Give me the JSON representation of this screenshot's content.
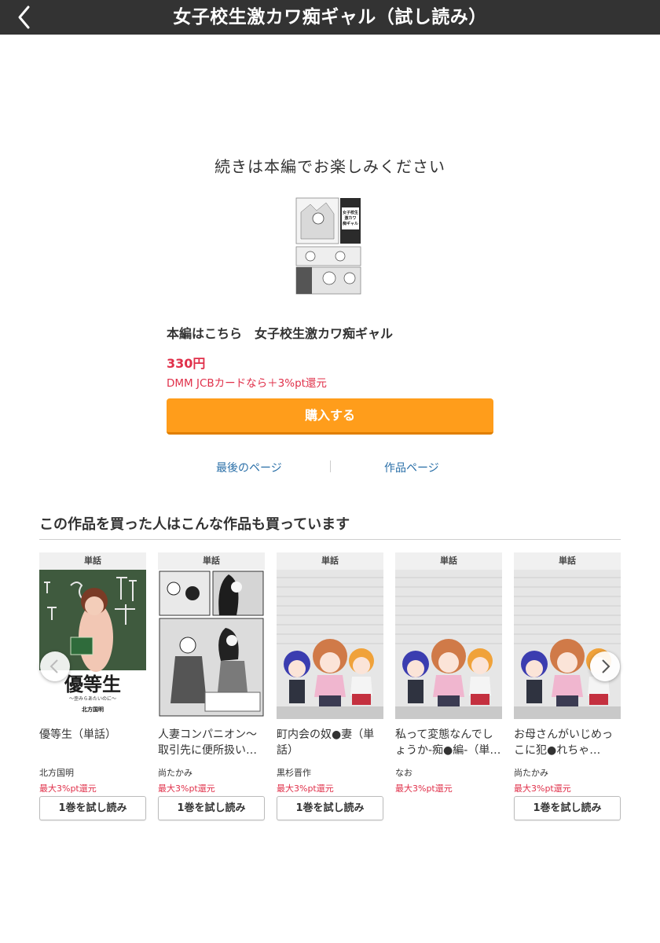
{
  "header": {
    "title": "女子校生激カワ痴ギャル（試し読み）",
    "back_icon": "chevron-left-icon"
  },
  "end_message": "続きは本編でお楽しみください",
  "product": {
    "buy_title": "本編はこちら　女子校生激カワ痴ギャル",
    "price": "330円",
    "promo": "DMM JCBカードなら＋3%pt還元",
    "buy_button": "購入する",
    "cover_lines": [
      "女子校生",
      "激カワ",
      "痴ギャル"
    ]
  },
  "links": {
    "last_page": "最後のページ",
    "work_page": "作品ページ"
  },
  "recommend": {
    "title": "この作品を買った人はこんな作品も買っています",
    "items": [
      {
        "badge": "単話",
        "name": "優等生（単話）",
        "author": "北方国明",
        "points": "最大3%pt還元",
        "trial": "1巻を試し読み",
        "cover_title": "優等生",
        "cover_sub": "〜歪みらあたいのに〜",
        "cover_author": "北方国明"
      },
      {
        "badge": "単話",
        "name": "人妻コンパニオン～取引先に便所扱い…",
        "author": "尚たかみ",
        "points": "最大3%pt還元",
        "trial": "1巻を試し読み"
      },
      {
        "badge": "単話",
        "name": "町内会の奴●妻（単話）",
        "author": "黒杉晋作",
        "points": "最大3%pt還元",
        "trial": "1巻を試し読み"
      },
      {
        "badge": "単話",
        "name": "私って変態なんでしょうか-痴●編-（単…",
        "author": "なお",
        "points": "最大3%pt還元",
        "trial": ""
      },
      {
        "badge": "単話",
        "name": "お母さんがいじめっこに犯●れちゃ…",
        "author": "尚たかみ",
        "points": "最大3%pt還元",
        "trial": "1巻を試し読み"
      }
    ]
  }
}
